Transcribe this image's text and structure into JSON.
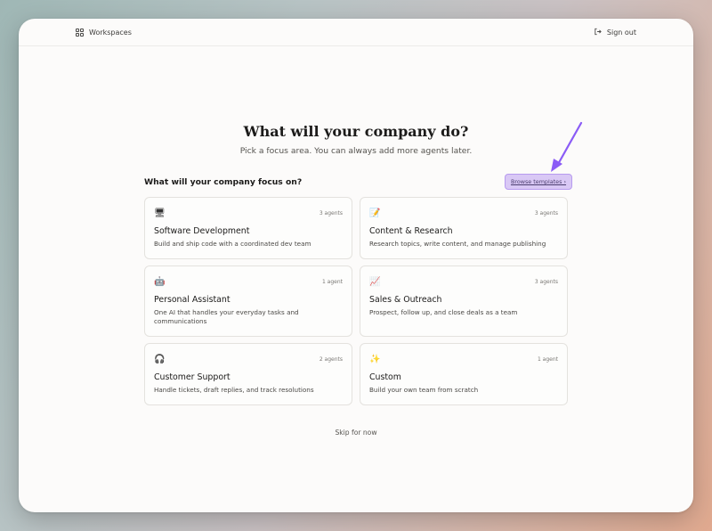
{
  "topbar": {
    "workspaces_label": "Workspaces",
    "workspaces_icon": "grid-icon",
    "signout_label": "Sign out",
    "signout_icon": "log-out-icon"
  },
  "main": {
    "title": "What will your company do?",
    "subtitle": "Pick a focus area. You can always add more agents later.",
    "focus_question": "What will your company focus on?",
    "browse_templates_label": "Browse templates ›",
    "skip_label": "Skip for now"
  },
  "cards": [
    {
      "icon": "desktop-computer-icon",
      "emoji": "🖥",
      "count": "3 agents",
      "name": "Software Development",
      "desc": "Build and ship code with a coordinated dev team"
    },
    {
      "icon": "memo-icon",
      "emoji": "📝",
      "count": "3 agents",
      "name": "Content & Research",
      "desc": "Research topics, write content, and manage publishing"
    },
    {
      "icon": "robot-icon",
      "emoji": "🤖",
      "count": "1 agent",
      "name": "Personal Assistant",
      "desc": "One AI that handles your everyday tasks and communications"
    },
    {
      "icon": "chart-increasing-icon",
      "emoji": "📈",
      "count": "3 agents",
      "name": "Sales & Outreach",
      "desc": "Prospect, follow up, and close deals as a team"
    },
    {
      "icon": "headphones-icon",
      "emoji": "🎧",
      "count": "2 agents",
      "name": "Customer Support",
      "desc": "Handle tickets, draft replies, and track resolutions"
    },
    {
      "icon": "sparkles-icon",
      "emoji": "✨",
      "count": "1 agent",
      "name": "Custom",
      "desc": "Build your own team from scratch"
    }
  ],
  "colors": {
    "accent_purple": "#8b5cf6",
    "browse_bg": "#d9c8f5"
  }
}
